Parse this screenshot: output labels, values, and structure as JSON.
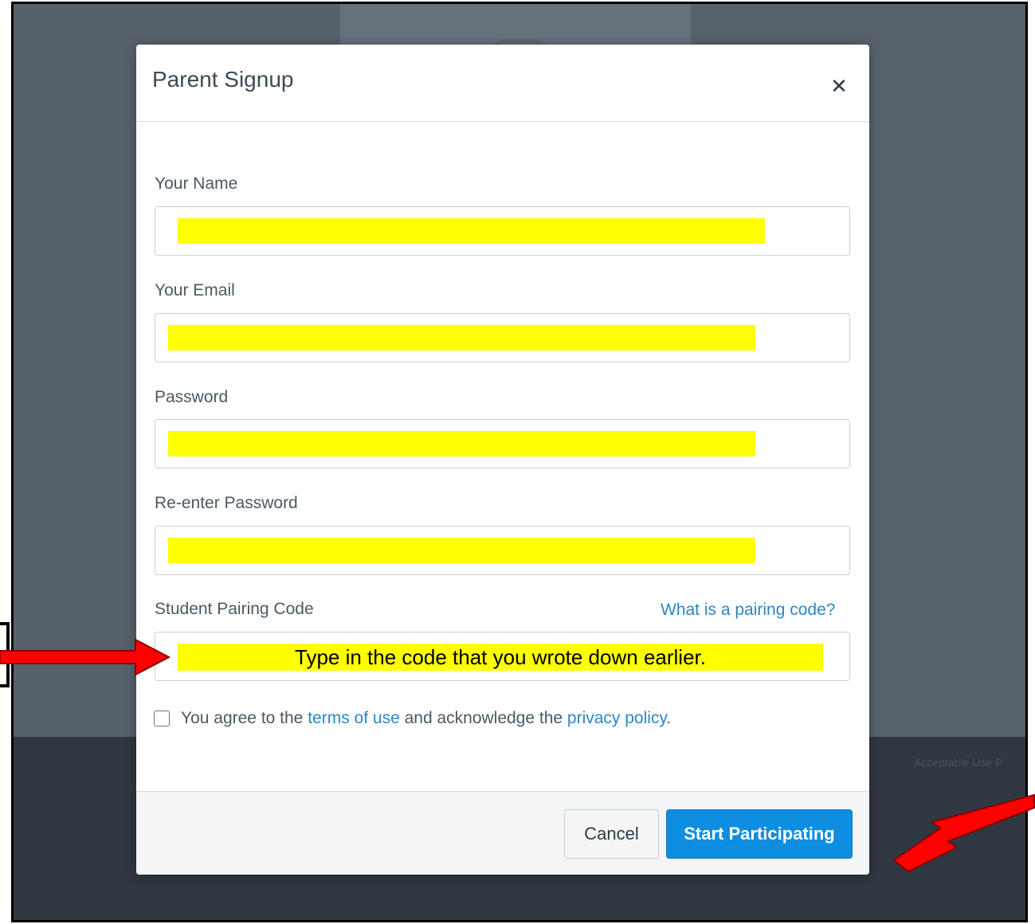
{
  "dialog": {
    "title": "Parent Signup",
    "close_icon": "close-icon"
  },
  "fields": [
    {
      "label": "Your Name",
      "value_redacted": true
    },
    {
      "label": "Your Email",
      "value_redacted": true
    },
    {
      "label": "Password",
      "value_redacted": true
    },
    {
      "label": "Re-enter Password",
      "value_redacted": true
    }
  ],
  "pairing": {
    "label": "Student Pairing Code",
    "help_link": "What is a pairing code?",
    "annotation": "Type in the code that you wrote down earlier."
  },
  "terms": {
    "text_before": "You agree to the ",
    "terms_link": "terms of use",
    "text_middle": " and acknowledge the ",
    "privacy_link": "privacy policy",
    "text_after": ".",
    "checked": false
  },
  "buttons": {
    "cancel": "Cancel",
    "start": "Start Participating"
  },
  "background": {
    "footer_link": "Acceptable Use P"
  },
  "colors": {
    "primary_button": "#0e8ee0",
    "link": "#2b87c5",
    "highlight": "#ffff00",
    "annotation_arrow": "#ff0000"
  }
}
